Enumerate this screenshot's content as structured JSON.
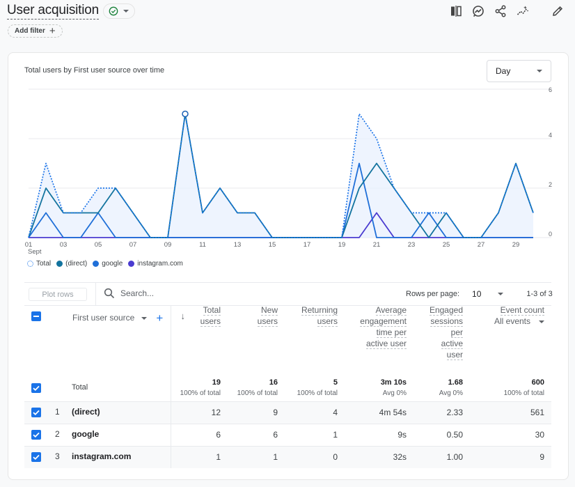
{
  "header": {
    "title": "User acquisition",
    "status_icon": "check-circle-icon",
    "add_filter_label": "Add filter",
    "toolbar_icons": [
      "compare-icon",
      "insights-icon",
      "share-icon",
      "trend-icon",
      "edit-icon"
    ]
  },
  "chart": {
    "title": "Total users by First user source over time",
    "granularity": "Day",
    "x_month_label": "Sept",
    "legend": [
      {
        "label": "Total",
        "color": "#1a73e8",
        "style": "dotted"
      },
      {
        "label": "(direct)",
        "color": "#12739e"
      },
      {
        "label": "google",
        "color": "#1f6fd8"
      },
      {
        "label": "instagram.com",
        "color": "#4a3bd0"
      }
    ]
  },
  "chart_data": {
    "type": "line",
    "title": "Total users by First user source over time",
    "xlabel": "Sept",
    "ylabel": "",
    "x": [
      1,
      2,
      3,
      4,
      5,
      6,
      7,
      8,
      9,
      10,
      11,
      12,
      13,
      14,
      15,
      16,
      17,
      18,
      19,
      20,
      21,
      22,
      23,
      24,
      25,
      26,
      27,
      28,
      29,
      30
    ],
    "x_tick_labels": [
      "01",
      "03",
      "05",
      "07",
      "09",
      "11",
      "13",
      "15",
      "17",
      "19",
      "21",
      "23",
      "25",
      "27",
      "29"
    ],
    "y_ticks": [
      0,
      2,
      4,
      6
    ],
    "ylim": [
      0,
      6
    ],
    "grid": true,
    "y_axis_side": "right",
    "legend_position": "bottom-left",
    "series": [
      {
        "name": "Total",
        "style": "dotted",
        "area": true,
        "color": "#1a73e8",
        "values": [
          0,
          3,
          1,
          1,
          2,
          2,
          1,
          0,
          0,
          5,
          1,
          2,
          1,
          1,
          0,
          0,
          0,
          0,
          0,
          5,
          4,
          2,
          1,
          1,
          1,
          0,
          0,
          1,
          3,
          1
        ],
        "highlight_index": 9
      },
      {
        "name": "(direct)",
        "color": "#12739e",
        "values": [
          0,
          2,
          1,
          1,
          1,
          2,
          1,
          0,
          0,
          5,
          1,
          2,
          1,
          1,
          0,
          0,
          0,
          0,
          0,
          2,
          3,
          2,
          1,
          0,
          1,
          0,
          0,
          1,
          3,
          1
        ]
      },
      {
        "name": "google",
        "color": "#1f6fd8",
        "values": [
          0,
          1,
          0,
          0,
          1,
          0,
          0,
          0,
          0,
          0,
          0,
          0,
          0,
          0,
          0,
          0,
          0,
          0,
          0,
          3,
          0,
          0,
          0,
          1,
          0,
          0,
          0,
          0,
          0,
          0
        ]
      },
      {
        "name": "instagram.com",
        "color": "#4a3bd0",
        "values": [
          0,
          0,
          0,
          0,
          0,
          0,
          0,
          0,
          0,
          0,
          0,
          0,
          0,
          0,
          0,
          0,
          0,
          0,
          0,
          0,
          1,
          0,
          0,
          0,
          0,
          0,
          0,
          0,
          0,
          0
        ]
      }
    ]
  },
  "table": {
    "plot_rows_label": "Plot rows",
    "search_placeholder": "Search...",
    "rows_per_page_label": "Rows per page:",
    "rows_per_page_value": "10",
    "range_label": "1-3 of 3",
    "dimension_header": "First user source",
    "columns": [
      {
        "lines": [
          "Total",
          "users"
        ]
      },
      {
        "lines": [
          "New",
          "users"
        ]
      },
      {
        "lines": [
          "Returning",
          "users"
        ]
      },
      {
        "lines": [
          "Average",
          "engagement",
          "time per",
          "active user"
        ]
      },
      {
        "lines": [
          "Engaged",
          "sessions",
          "per",
          "active",
          "user"
        ]
      },
      {
        "lines": [
          "Event count"
        ],
        "selector": "All events"
      }
    ],
    "totals": {
      "label": "Total",
      "values": [
        "19",
        "16",
        "5",
        "3m 10s",
        "1.68",
        "600"
      ],
      "subs": [
        "100% of total",
        "100% of total",
        "100% of total",
        "Avg 0%",
        "Avg 0%",
        "100% of total"
      ]
    },
    "rows": [
      {
        "index": "1",
        "name": "(direct)",
        "values": [
          "12",
          "9",
          "4",
          "4m 54s",
          "2.33",
          "561"
        ]
      },
      {
        "index": "2",
        "name": "google",
        "values": [
          "6",
          "6",
          "1",
          "9s",
          "0.50",
          "30"
        ]
      },
      {
        "index": "3",
        "name": "instagram.com",
        "values": [
          "1",
          "1",
          "0",
          "32s",
          "1.00",
          "9"
        ]
      }
    ]
  }
}
